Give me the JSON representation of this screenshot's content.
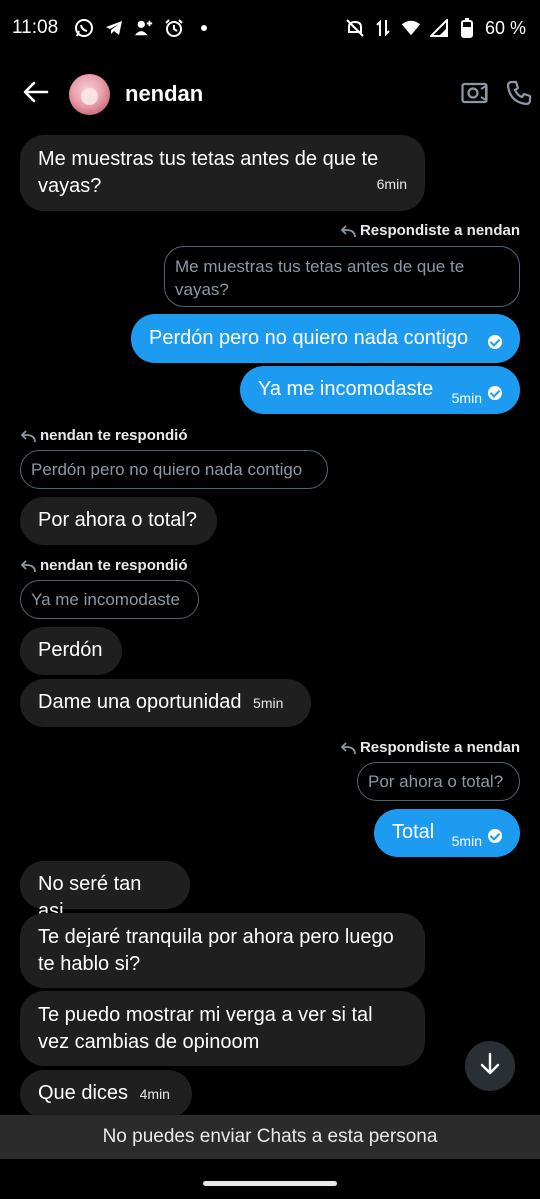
{
  "status_bar": {
    "time": "11:08",
    "battery": "60 %",
    "left_icons": [
      "whatsapp-icon",
      "telegram-icon",
      "add-person-icon",
      "alarm-icon",
      "dot-icon"
    ],
    "right_icons": [
      "mute-icon",
      "data-arrows-icon",
      "wifi-icon",
      "signal-icon",
      "battery-icon"
    ]
  },
  "header": {
    "contact_name": "nendan",
    "icons": [
      "back-arrow-icon",
      "video-camera-icon",
      "phone-icon"
    ]
  },
  "colors": {
    "outgoing_bubble": "#1d9bf0",
    "incoming_bubble": "#1f1f1f",
    "background": "#000000"
  },
  "messages": {
    "m1": {
      "text": "Me muestras tus tetas antes de que te vayas?",
      "time": "6min"
    },
    "r1_label": "Respondiste a nendan",
    "r1_quote": "Me muestras tus tetas antes de que te vayas?",
    "m2": {
      "text": "Perdón pero no quiero nada contigo"
    },
    "m3": {
      "text": "Ya me incomodaste",
      "time": "5min"
    },
    "r2_label": "nendan te respondió",
    "r2_quote": "Perdón pero no quiero nada contigo",
    "m4": {
      "text": "Por ahora o total?"
    },
    "r3_label": "nendan te respondió",
    "r3_quote": "Ya me incomodaste",
    "m5": {
      "text": "Perdón"
    },
    "m6": {
      "text": "Dame una oportunidad",
      "time": "5min"
    },
    "r4_label": "Respondiste a nendan",
    "r4_quote": "Por ahora o total?",
    "m7": {
      "text": "Total",
      "time": "5min"
    },
    "m8": {
      "text": "No seré tan asi"
    },
    "m9": {
      "text": "Te dejaré tranquila por ahora pero luego te hablo si?"
    },
    "m10": {
      "text": "Te puedo mostrar mi verga a ver si tal vez cambias de opinoom"
    },
    "m11": {
      "text": "Que dices",
      "time": "4min"
    }
  },
  "footer": {
    "blocked_text": "No puedes enviar Chats a esta persona"
  }
}
